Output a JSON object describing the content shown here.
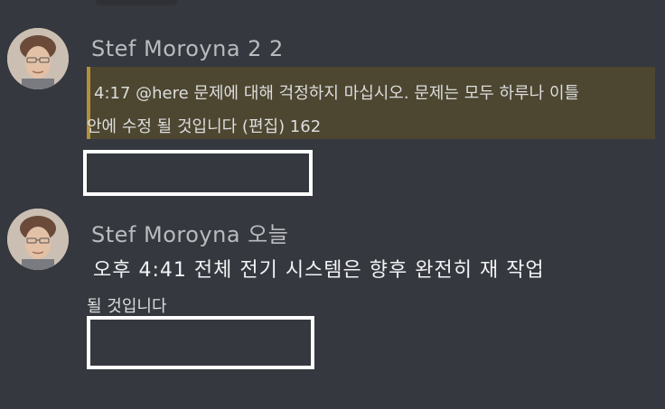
{
  "messages": [
    {
      "username": "Stef Moroyna 2 2",
      "text_line1": "4:17 @here 문제에 대해 걱정하지 마십시오. 문제는 모두 하루나 이틀",
      "text_line2": "안에 수정 될 것입니다 (편집) 162",
      "highlight_color": "#4d4630",
      "highlight_bar_color": "#b4903a"
    },
    {
      "username": "Stef Moroyna 오늘",
      "text_line1": "오후 4:41 전체 전기 시스템은 향후 완전히 재 작업",
      "text_line2": "될 것입니다"
    }
  ],
  "colors": {
    "background": "#35383e",
    "username": "#b9bbbe",
    "message_text": "#dcddde",
    "redaction_box": "#ffffff"
  },
  "icons": [
    "avatar"
  ]
}
